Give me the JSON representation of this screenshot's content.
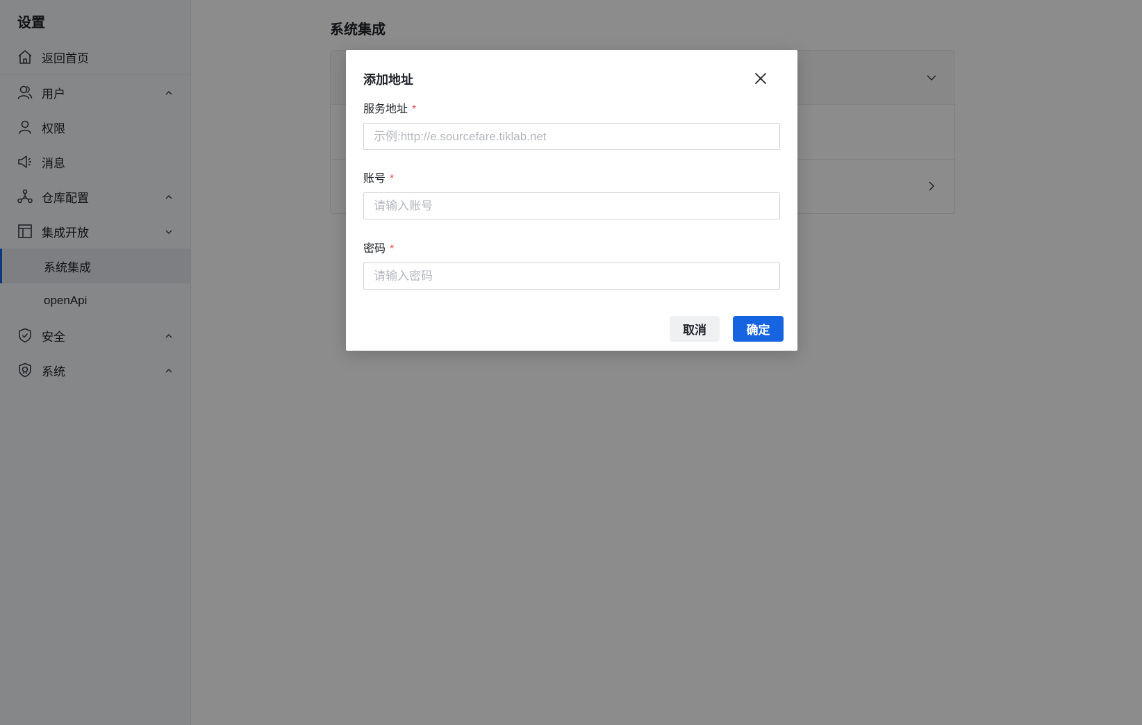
{
  "sidebar": {
    "title": "设置",
    "items": [
      {
        "label": "返回首页",
        "icon": "home-icon"
      },
      {
        "label": "用户",
        "icon": "users-icon",
        "chevron": "up"
      },
      {
        "label": "权限",
        "icon": "user-icon"
      },
      {
        "label": "消息",
        "icon": "megaphone-icon"
      },
      {
        "label": "仓库配置",
        "icon": "network-icon",
        "chevron": "up"
      },
      {
        "label": "集成开放",
        "icon": "layout-icon",
        "chevron": "down"
      },
      {
        "label": "安全",
        "icon": "shield-check-icon",
        "chevron": "up"
      },
      {
        "label": "系统",
        "icon": "shield-certificate-icon",
        "chevron": "up"
      }
    ],
    "sub_items": [
      {
        "label": "系统集成",
        "active": true
      },
      {
        "label": "openApi",
        "active": false
      }
    ]
  },
  "main": {
    "title": "系统集成"
  },
  "modal": {
    "title": "添加地址",
    "fields": [
      {
        "label": "服务地址",
        "required_mark": "*",
        "value": "",
        "placeholder": "示例:http://e.sourcefare.tiklab.net"
      },
      {
        "label": "账号",
        "required_mark": "*",
        "value": "",
        "placeholder": "请输入账号"
      },
      {
        "label": "密码",
        "required_mark": "*",
        "value": "",
        "placeholder": "请输入密码"
      }
    ],
    "cancel_label": "取消",
    "ok_label": "确定"
  },
  "colors": {
    "primary": "#1664e0",
    "required": "#e34d59",
    "sidebar_bg": "#f5f6f8",
    "active_item_bg": "#e3e7ee"
  }
}
